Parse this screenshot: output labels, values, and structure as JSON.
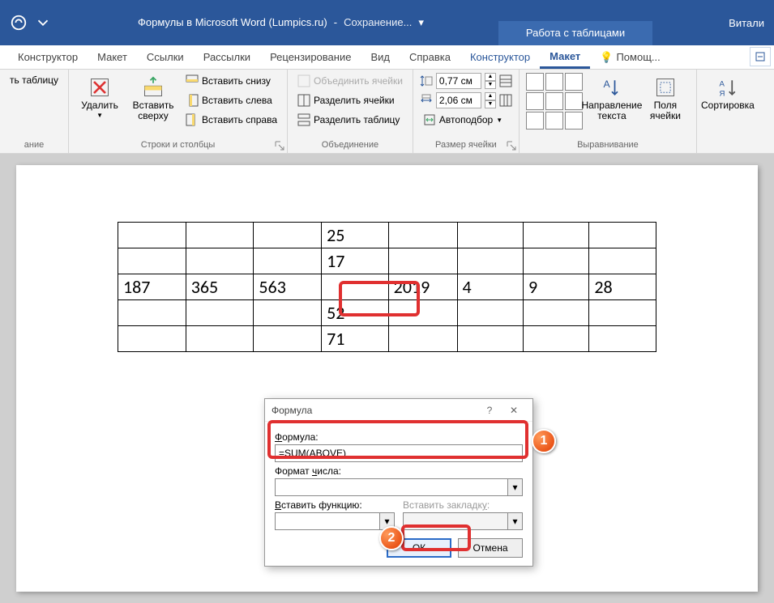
{
  "title": {
    "doc": "Формулы в Microsoft Word (Lumpics.ru)",
    "saving": "Сохранение...",
    "table_tools": "Работа с таблицами",
    "user": "Витали"
  },
  "tabs": {
    "constructor1": "Конструктор",
    "layout1": "Макет",
    "references": "Ссылки",
    "mailings": "Рассылки",
    "review": "Рецензирование",
    "view": "Вид",
    "help": "Справка",
    "constructor2": "Конструктор",
    "layout2": "Макет",
    "tell_me": "Помощ..."
  },
  "ribbon": {
    "draw_table": "ть таблицу",
    "delete": "Удалить",
    "insert_top": "Вставить сверху",
    "insert_below": "Вставить снизу",
    "insert_left": "Вставить слева",
    "insert_right": "Вставить справа",
    "merge": "Объединить ячейки",
    "split_cells": "Разделить ячейки",
    "split_table": "Разделить таблицу",
    "height": "0,77 см",
    "width": "2,06 см",
    "autofit": "Автоподбор",
    "text_dir": "Направление текста",
    "cell_margins": "Поля ячейки",
    "sort": "Сортировка",
    "g_table": "ание",
    "g_rowscols": "Строки и столбцы",
    "g_merge": "Объединение",
    "g_size": "Размер ячейки",
    "g_align": "Выравнивание"
  },
  "table": {
    "r1c4": "25",
    "r2c4": "17",
    "r3c1": "187",
    "r3c2": "365",
    "r3c3": "563",
    "r3c5": "2019",
    "r3c6": "4",
    "r3c7": "9",
    "r3c8": "28",
    "r4c4": "52",
    "r5c4": "71"
  },
  "dialog": {
    "title": "Формула",
    "formula_label": "Формула:",
    "formula_value": "=SUM(ABOVE)",
    "format_label": "Формат числа:",
    "func_label": "Вставить функцию:",
    "bookmark_label": "Вставить закладку:",
    "ok": "ОК",
    "cancel": "Отмена"
  },
  "badges": {
    "one": "1",
    "two": "2"
  }
}
